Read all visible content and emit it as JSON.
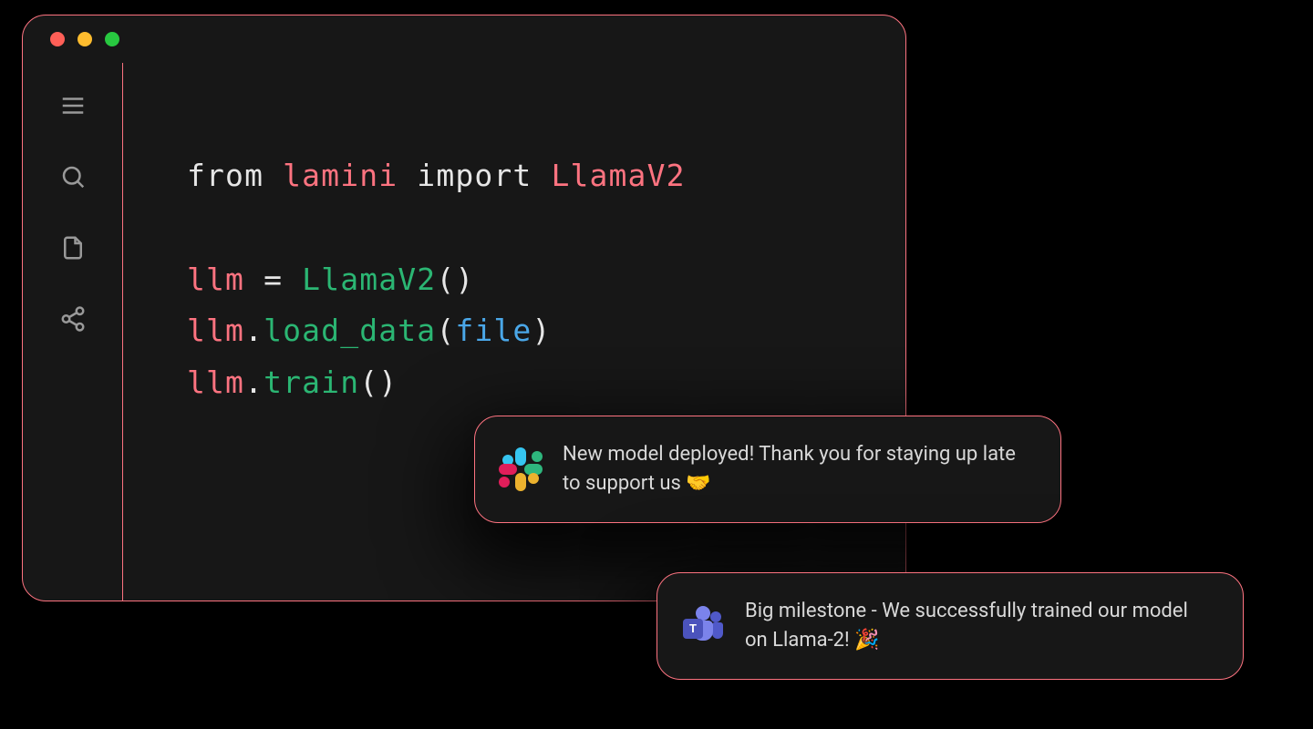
{
  "code": {
    "line1": {
      "kw_from": "from",
      "module": "lamini",
      "kw_import": "import",
      "symbol": "LlamaV2"
    },
    "line3": {
      "var": "llm",
      "eq": "=",
      "ctor": "LlamaV2",
      "parens": "()"
    },
    "line4": {
      "var": "llm",
      "dot": ".",
      "fn": "load_data",
      "lp": "(",
      "arg": "file",
      "rp": ")"
    },
    "line5": {
      "var": "llm",
      "dot": ".",
      "fn": "train",
      "parens": "()"
    }
  },
  "toasts": {
    "slack": {
      "text": "New model deployed! Thank you for staying up late to support us 🤝"
    },
    "teams": {
      "text": "Big milestone - We successfully trained our model on Llama-2! 🎉",
      "tile_letter": "T"
    }
  }
}
